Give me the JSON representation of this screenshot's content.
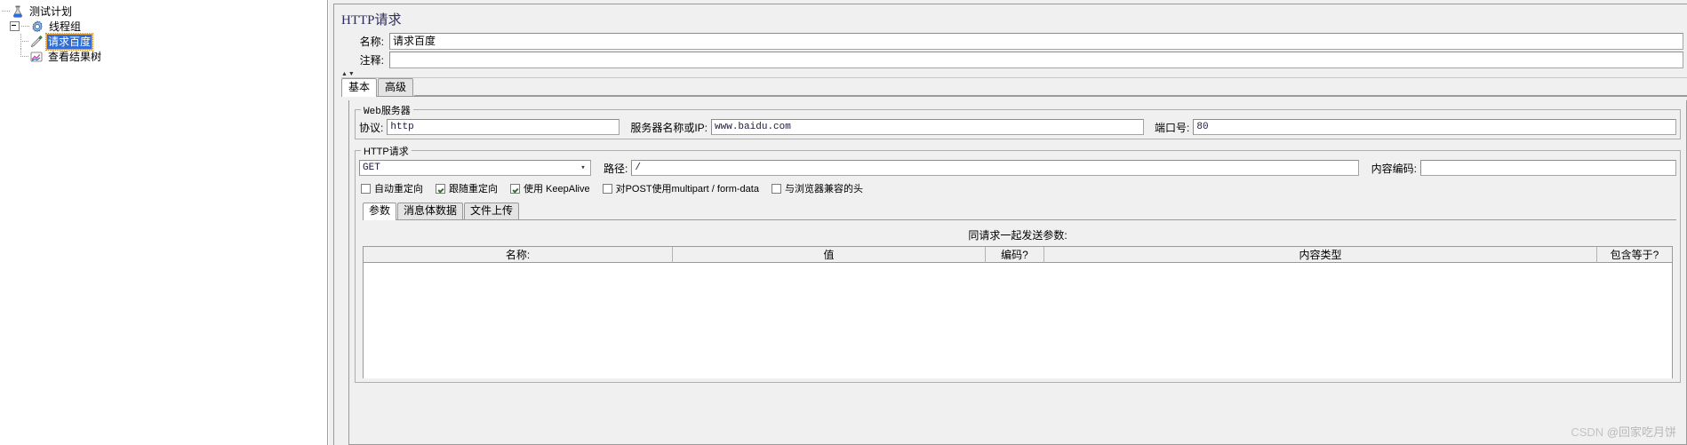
{
  "tree": {
    "nodes": [
      {
        "label": "测试计划",
        "icon": "test-plan-icon",
        "selected": false,
        "depth": 0,
        "expander": "none"
      },
      {
        "label": "线程组",
        "icon": "thread-group-icon",
        "selected": false,
        "depth": 1,
        "expander": "minus"
      },
      {
        "label": "请求百度",
        "icon": "http-sampler-icon",
        "selected": true,
        "depth": 2,
        "expander": "none"
      },
      {
        "label": "查看结果树",
        "icon": "view-results-tree-icon",
        "selected": false,
        "depth": 2,
        "expander": "none"
      }
    ]
  },
  "panel": {
    "title": "HTTP请求",
    "name_label": "名称:",
    "name_value": "请求百度",
    "comment_label": "注释:",
    "comment_value": "",
    "tabs": [
      {
        "label": "基本",
        "active": true
      },
      {
        "label": "高级",
        "active": false
      }
    ],
    "web_server": {
      "group_title_prefix": "Web",
      "group_title_suffix": "服务器",
      "protocol_label": "协议:",
      "protocol_value": "http",
      "server_label": "服务器名称或IP:",
      "server_value": "www.baidu.com",
      "port_label": "端口号:",
      "port_value": "80"
    },
    "http_request": {
      "group_title": "HTTP请求",
      "method_value": "GET",
      "path_label": "路径:",
      "path_value": "/",
      "encoding_label": "内容编码:",
      "encoding_value": "",
      "checkboxes": [
        {
          "label": "自动重定向",
          "checked": false
        },
        {
          "label": "跟随重定向",
          "checked": true
        },
        {
          "label": "使用 KeepAlive",
          "checked": true
        },
        {
          "label": "对POST使用multipart / form-data",
          "checked": false
        },
        {
          "label": "与浏览器兼容的头",
          "checked": false
        }
      ],
      "inner_tabs": [
        {
          "label": "参数",
          "active": true
        },
        {
          "label": "消息体数据",
          "active": false
        },
        {
          "label": "文件上传",
          "active": false
        }
      ],
      "params_caption": "同请求一起发送参数:",
      "params_table": {
        "columns": [
          "名称:",
          "值",
          "编码?",
          "内容类型",
          "包含等于?"
        ],
        "rows": []
      }
    }
  },
  "watermark": {
    "brand": "CSDN",
    "handle": "@回家吃月饼"
  },
  "colors": {
    "selection_blue": "#2e6ed6",
    "focus_orange": "#e8a33d",
    "title_navy": "#2b2b5e",
    "panel_gray": "#f0f0f0"
  }
}
